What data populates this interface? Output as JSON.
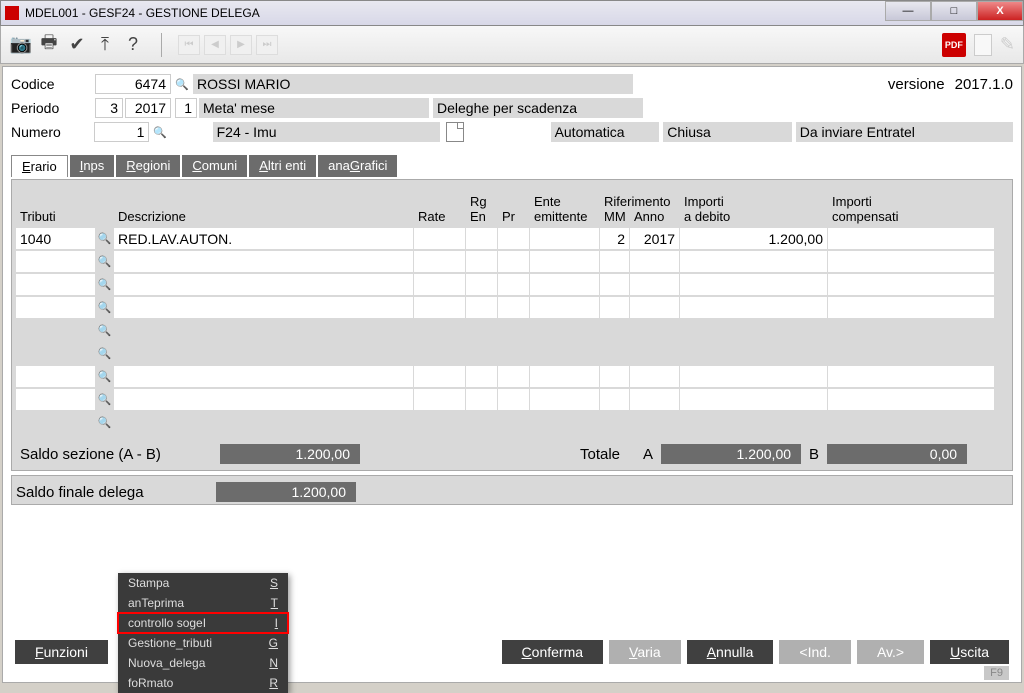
{
  "window": {
    "title": "MDEL001 - GESF24 -  GESTIONE DELEGA",
    "min": "—",
    "max": "□",
    "close": "X"
  },
  "toolbar": {
    "pdf": "PDF"
  },
  "header": {
    "version_label": "versione",
    "version": "2017.1.0",
    "codice_label": "Codice",
    "codice": "6474",
    "nome": "ROSSI MARIO",
    "periodo_label": "Periodo",
    "periodo_m": "3",
    "periodo_y": "2017",
    "periodo_n": "1",
    "periodo_desc": "Meta' mese",
    "deleghe": "Deleghe per scadenza",
    "numero_label": "Numero",
    "numero": "1",
    "f24": "F24 - Imu",
    "automatica": "Automatica",
    "chiusa": "Chiusa",
    "entratel": "Da inviare Entratel"
  },
  "tabs": {
    "erario": "Erario",
    "inps": "Inps",
    "regioni": "Regioni",
    "comuni": "Comuni",
    "altri": "Altri enti",
    "anagrafici": "anaGrafici"
  },
  "grid_headers": {
    "tributi": "Tributi",
    "descrizione": "Descrizione",
    "rate": "Rate",
    "rg": "Rg",
    "en": "En",
    "pr": "Pr",
    "ente": "Ente",
    "emittente": "emittente",
    "riferimento": "Riferimento",
    "mm": "MM",
    "anno": "Anno",
    "importi": "Importi",
    "debito": "a debito",
    "importi2": "Importi",
    "compensati": "compensati"
  },
  "rows": [
    {
      "trib": "1040",
      "desc": "RED.LAV.AUTON.",
      "rate": "",
      "rgen": "",
      "pr": "",
      "ente": "",
      "mm": "2",
      "anno": "2017",
      "debito": "1.200,00",
      "comp": ""
    },
    {
      "trib": "",
      "desc": "",
      "rate": "",
      "rgen": "",
      "pr": "",
      "ente": "",
      "mm": "",
      "anno": "",
      "debito": "",
      "comp": ""
    },
    {
      "trib": "",
      "desc": "",
      "rate": "",
      "rgen": "",
      "pr": "",
      "ente": "",
      "mm": "",
      "anno": "",
      "debito": "",
      "comp": ""
    },
    {
      "trib": "",
      "desc": "",
      "rate": "",
      "rgen": "",
      "pr": "",
      "ente": "",
      "mm": "",
      "anno": "",
      "debito": "",
      "comp": ""
    },
    {
      "trib": "",
      "desc": "",
      "rate": "",
      "rgen": "",
      "pr": "",
      "ente": "",
      "mm": "",
      "anno": "",
      "debito": "",
      "comp": ""
    },
    {
      "trib": "",
      "desc": "",
      "rate": "",
      "rgen": "",
      "pr": "",
      "ente": "",
      "mm": "",
      "anno": "",
      "debito": "",
      "comp": ""
    },
    {
      "trib": "",
      "desc": "",
      "rate": "",
      "rgen": "",
      "pr": "",
      "ente": "",
      "mm": "",
      "anno": "",
      "debito": "",
      "comp": ""
    },
    {
      "trib": "",
      "desc": "",
      "rate": "",
      "rgen": "",
      "pr": "",
      "ente": "",
      "mm": "",
      "anno": "",
      "debito": "",
      "comp": ""
    },
    {
      "trib": "",
      "desc": "",
      "rate": "",
      "rgen": "",
      "pr": "",
      "ente": "",
      "mm": "",
      "anno": "",
      "debito": "",
      "comp": ""
    }
  ],
  "saldo": {
    "sezione_label": "Saldo sezione (A - B)",
    "sezione_val": "1.200,00",
    "totale_label": "Totale",
    "a_label": "A",
    "a_val": "1.200,00",
    "b_label": "B",
    "b_val": "0,00",
    "finale_label": "Saldo finale delega",
    "finale_val": "1.200,00"
  },
  "buttons": {
    "funzioni": "Funzioni",
    "conferma": "Conferma",
    "varia": "Varia",
    "annulla": "Annulla",
    "ind": "<Ind.",
    "av": "Av.>",
    "uscita": "Uscita"
  },
  "f9": "F9",
  "context": {
    "stampa": {
      "label": "Stampa",
      "key": "S"
    },
    "anteprima": {
      "label": "anTeprima",
      "key": "T"
    },
    "sogei": {
      "label": "controllo sogeI",
      "key": "I"
    },
    "tributi": {
      "label": "Gestione_tributi",
      "key": "G"
    },
    "nuova": {
      "label": "Nuova_delega",
      "key": "N"
    },
    "formato": {
      "label": "foRmato",
      "key": "R"
    }
  }
}
